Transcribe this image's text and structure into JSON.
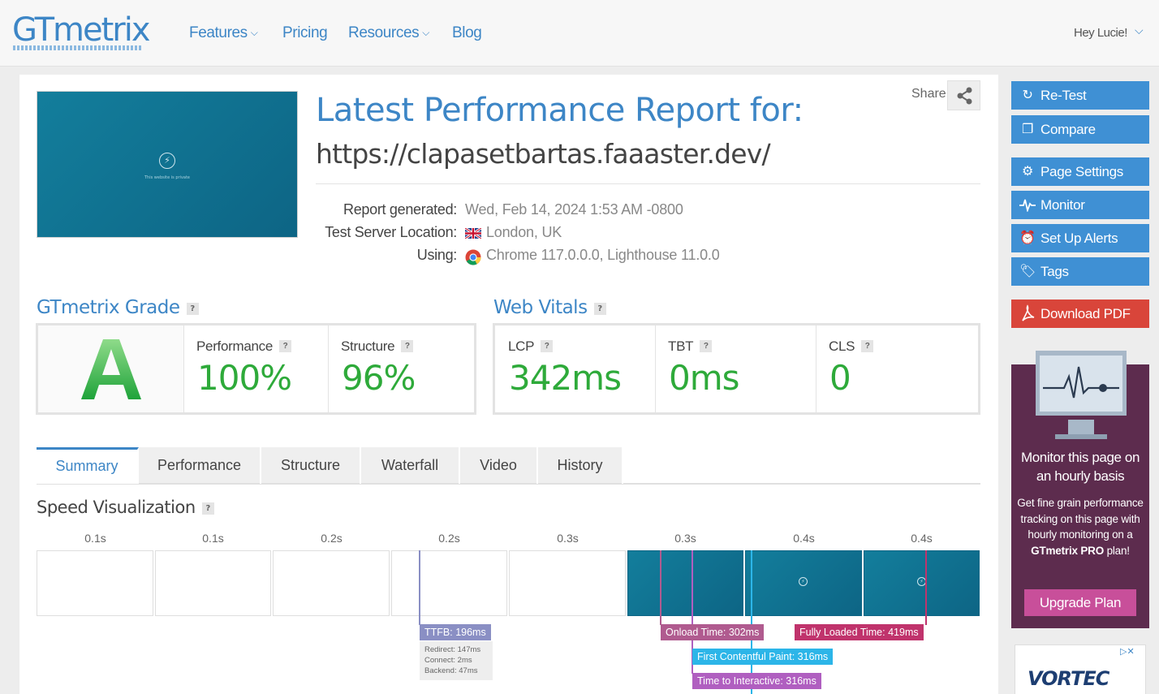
{
  "header": {
    "logo": "GTmetrix",
    "nav": [
      {
        "label": "Features",
        "has_dropdown": true
      },
      {
        "label": "Pricing",
        "has_dropdown": false
      },
      {
        "label": "Resources",
        "has_dropdown": true
      },
      {
        "label": "Blog",
        "has_dropdown": false
      }
    ],
    "user_greeting": "Hey Lucie!"
  },
  "report": {
    "title": "Latest Performance Report for:",
    "url": "https://clapasetbartas.faaaster.dev/",
    "share_label": "Share",
    "thumbnail_text": "This website is private",
    "meta": [
      {
        "label": "Report generated:",
        "value": "Wed, Feb 14, 2024 1:53 AM -0800",
        "icon": ""
      },
      {
        "label": "Test Server Location:",
        "value": "London, UK",
        "icon": "uk-flag-icon"
      },
      {
        "label": "Using:",
        "value": "Chrome 117.0.0.0, Lighthouse 11.0.0",
        "icon": "chrome-icon"
      }
    ]
  },
  "grade": {
    "title": "GTmetrix Grade",
    "letter": "A",
    "performance_label": "Performance",
    "performance_value": "100%",
    "structure_label": "Structure",
    "structure_value": "96%"
  },
  "vitals": {
    "title": "Web Vitals",
    "items": [
      {
        "label": "LCP",
        "value": "342ms"
      },
      {
        "label": "TBT",
        "value": "0ms"
      },
      {
        "label": "CLS",
        "value": "0"
      }
    ]
  },
  "tabs": [
    "Summary",
    "Performance",
    "Structure",
    "Waterfall",
    "Video",
    "History"
  ],
  "active_tab": "Summary",
  "speed_viz": {
    "title": "Speed Visualization",
    "ticks": [
      "0.1s",
      "0.1s",
      "0.2s",
      "0.2s",
      "0.3s",
      "0.3s",
      "0.4s",
      "0.4s"
    ],
    "markers": {
      "ttfb": "TTFB: 196ms",
      "redirect": "Redirect: 147ms",
      "connect": "Connect: 2ms",
      "backend": "Backend: 47ms",
      "onload": "Onload Time: 302ms",
      "fully_loaded": "Fully Loaded Time: 419ms",
      "fcp": "First Contentful Paint: 316ms",
      "tti": "Time to Interactive: 316ms"
    },
    "colors": {
      "ttfb": "#8a8fc4",
      "onload": "#b05b8f",
      "fully_loaded": "#c0336c",
      "fcp": "#2cb5e8",
      "tti": "#b05fc0"
    }
  },
  "sidebar": {
    "buttons": [
      {
        "label": "Re-Test",
        "icon": "refresh-icon"
      },
      {
        "label": "Compare",
        "icon": "copy-icon"
      },
      {
        "label": "Page Settings",
        "icon": "gear-icon"
      },
      {
        "label": "Monitor",
        "icon": "pulse-icon"
      },
      {
        "label": "Set Up Alerts",
        "icon": "alarm-icon"
      },
      {
        "label": "Tags",
        "icon": "tag-icon"
      },
      {
        "label": "Download PDF",
        "icon": "pdf-icon"
      }
    ],
    "promo": {
      "title": "Monitor this page on an hourly basis",
      "body": "Get fine grain performance tracking on this page with hourly monitoring on a",
      "brand": "GTmetrix PRO",
      "body_suffix": "plan!",
      "button": "Upgrade Plan"
    },
    "ad_text": "VORTEC"
  },
  "colors": {
    "brand_blue": "#3d86c6",
    "grade_green": "#2eaa3a",
    "sidebar_button": "#3f90d4",
    "pdf_button": "#d9453a",
    "promo_bg": "#5d2c4e",
    "upgrade_button": "#c84f9a"
  }
}
